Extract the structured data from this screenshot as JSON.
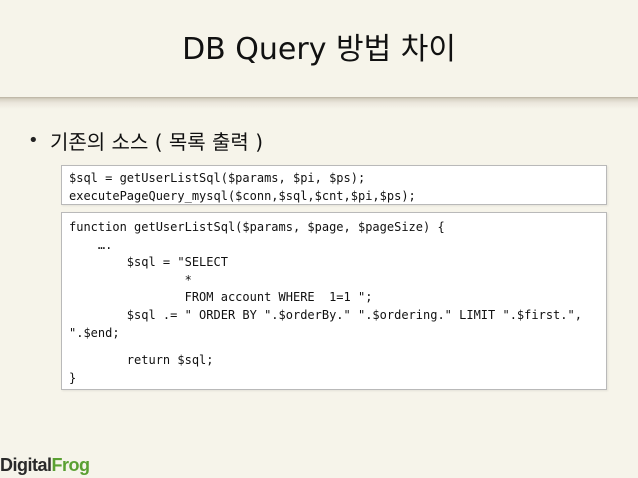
{
  "slide": {
    "title": "DB Query  방법 차이",
    "bullet": {
      "marker": "•",
      "text": "기존의 소스  ( 목록 출력 )"
    },
    "code_block_1": {
      "lines": [
        "$sql = getUserListSql($params, $pi, $ps);",
        "executePageQuery_mysql($conn,$sql,$cnt,$pi,$ps);"
      ]
    },
    "code_block_2": {
      "lines": [
        "function getUserListSql($params, $page, $pageSize) {",
        "    ….",
        "        $sql = \"SELECT",
        "                *",
        "                FROM account WHERE  1=1 \";",
        "        $sql .= \" ORDER BY \".$orderBy.\" \".$ordering.\" LIMIT \".$first.\",",
        "\".$end;",
        "",
        "        return $sql;",
        "}"
      ]
    },
    "logo": {
      "part1": "Digital",
      "part2": "Frog"
    }
  }
}
